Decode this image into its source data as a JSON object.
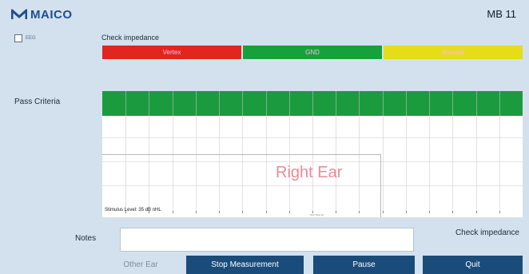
{
  "header": {
    "brand": "MAICO",
    "device": "MB 11"
  },
  "eeg": {
    "label": "EEG",
    "checked": false
  },
  "impedance": {
    "title": "Check impedance",
    "segments": [
      {
        "label": "Vertex",
        "color": "#e0261f"
      },
      {
        "label": "GND",
        "color": "#17a13b"
      },
      {
        "label": "Mastoid",
        "color": "#e6dc1a"
      }
    ]
  },
  "pass_criteria": {
    "label": "Pass Criteria",
    "band_color": "#1c9b3e"
  },
  "chart": {
    "ear_label": "Right Ear",
    "stimulus_level": "Stimulus Level: 35 dB nHL",
    "x_axis_label": "Test Time (s)"
  },
  "notes": {
    "label": "Notes",
    "value": ""
  },
  "check_impedance_link": "Check impedance",
  "buttons": {
    "other_ear": "Other Ear",
    "stop": "Stop Measurement",
    "pause": "Pause",
    "quit": "Quit"
  },
  "colors": {
    "accent": "#1a4c7b",
    "background": "#d3e1ee"
  }
}
